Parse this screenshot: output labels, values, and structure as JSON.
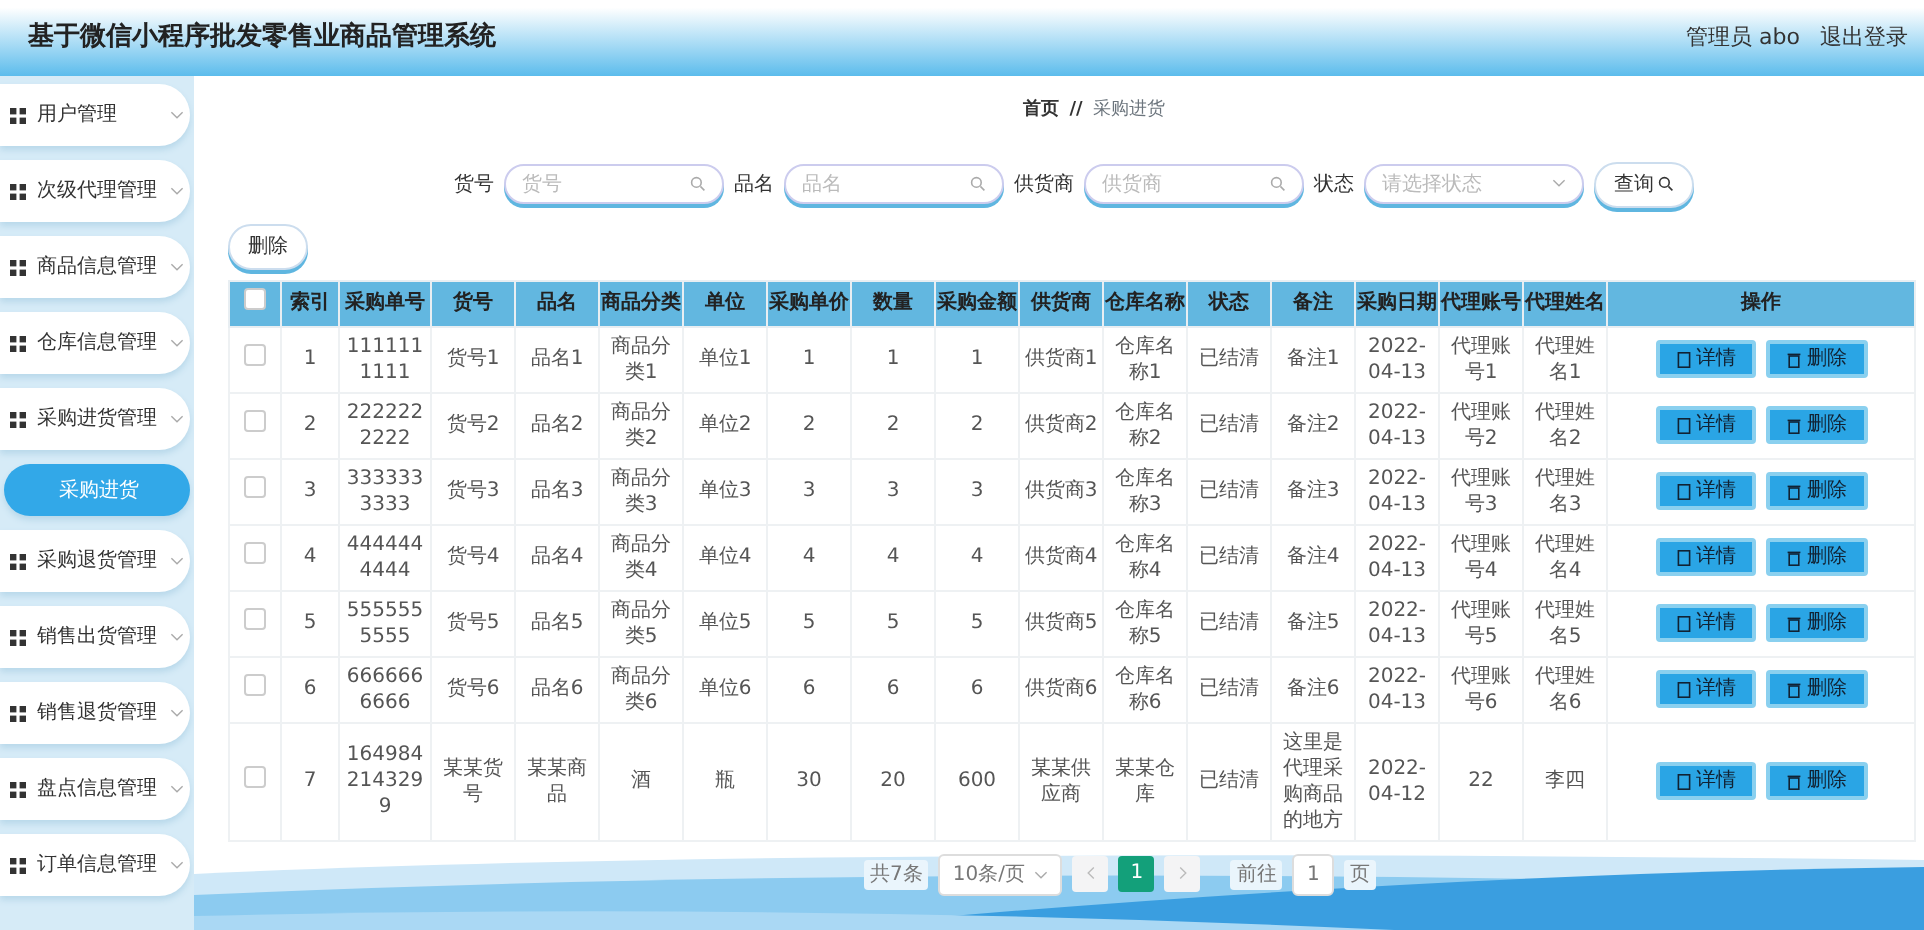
{
  "header": {
    "title": "基于微信小程序批发零售业商品管理系统",
    "user": "管理员 abo",
    "logout": "退出登录"
  },
  "sidebar": {
    "items": [
      {
        "kind": "menu",
        "label": "用户管理",
        "selected": false
      },
      {
        "kind": "menu",
        "label": "次级代理管理",
        "selected": false
      },
      {
        "kind": "menu",
        "label": "商品信息管理",
        "selected": false
      },
      {
        "kind": "menu",
        "label": "仓库信息管理",
        "selected": false
      },
      {
        "kind": "menu",
        "label": "采购进货管理",
        "selected": false
      },
      {
        "kind": "submenu",
        "label": "采购进货",
        "selected": true
      },
      {
        "kind": "menu",
        "label": "采购退货管理",
        "selected": false
      },
      {
        "kind": "menu",
        "label": "销售出货管理",
        "selected": false
      },
      {
        "kind": "menu",
        "label": "销售退货管理",
        "selected": false
      },
      {
        "kind": "menu",
        "label": "盘点信息管理",
        "selected": false
      },
      {
        "kind": "menu",
        "label": "订单信息管理",
        "selected": false
      }
    ]
  },
  "breadcrumb": {
    "home": "首页",
    "separator": "//",
    "current": "采购进货"
  },
  "filters": [
    {
      "kind": "search",
      "label": "货号",
      "placeholder": "货号"
    },
    {
      "kind": "search",
      "label": "品名",
      "placeholder": "品名"
    },
    {
      "kind": "search",
      "label": "供货商",
      "placeholder": "供货商"
    },
    {
      "kind": "select",
      "label": "状态",
      "placeholder": "请选择状态"
    }
  ],
  "query_button": "查询",
  "delete_button": "删除",
  "table": {
    "select_all_checked": false,
    "columns": [
      "索引",
      "采购单号",
      "货号",
      "品名",
      "商品分类",
      "单位",
      "采购单价",
      "数量",
      "采购金额",
      "供货商",
      "仓库名称",
      "状态",
      "备注",
      "采购日期",
      "代理账号",
      "代理姓名",
      "操作"
    ],
    "rows": [
      {
        "checked": false,
        "cells": [
          "1",
          "1111111111",
          "货号1",
          "品名1",
          "商品分类1",
          "单位1",
          "1",
          "1",
          "1",
          "供货商1",
          "仓库名称1",
          "已结清",
          "备注1",
          "2022-04-13",
          "代理账号1",
          "代理姓名1"
        ],
        "actions": [
          "详情",
          "删除"
        ]
      },
      {
        "checked": false,
        "cells": [
          "2",
          "2222222222",
          "货号2",
          "品名2",
          "商品分类2",
          "单位2",
          "2",
          "2",
          "2",
          "供货商2",
          "仓库名称2",
          "已结清",
          "备注2",
          "2022-04-13",
          "代理账号2",
          "代理姓名2"
        ],
        "actions": [
          "详情",
          "删除"
        ]
      },
      {
        "checked": false,
        "cells": [
          "3",
          "3333333333",
          "货号3",
          "品名3",
          "商品分类3",
          "单位3",
          "3",
          "3",
          "3",
          "供货商3",
          "仓库名称3",
          "已结清",
          "备注3",
          "2022-04-13",
          "代理账号3",
          "代理姓名3"
        ],
        "actions": [
          "详情",
          "删除"
        ]
      },
      {
        "checked": false,
        "cells": [
          "4",
          "4444444444",
          "货号4",
          "品名4",
          "商品分类4",
          "单位4",
          "4",
          "4",
          "4",
          "供货商4",
          "仓库名称4",
          "已结清",
          "备注4",
          "2022-04-13",
          "代理账号4",
          "代理姓名4"
        ],
        "actions": [
          "详情",
          "删除"
        ]
      },
      {
        "checked": false,
        "cells": [
          "5",
          "5555555555",
          "货号5",
          "品名5",
          "商品分类5",
          "单位5",
          "5",
          "5",
          "5",
          "供货商5",
          "仓库名称5",
          "已结清",
          "备注5",
          "2022-04-13",
          "代理账号5",
          "代理姓名5"
        ],
        "actions": [
          "详情",
          "删除"
        ]
      },
      {
        "checked": false,
        "cells": [
          "6",
          "6666666666",
          "货号6",
          "品名6",
          "商品分类6",
          "单位6",
          "6",
          "6",
          "6",
          "供货商6",
          "仓库名称6",
          "已结清",
          "备注6",
          "2022-04-13",
          "代理账号6",
          "代理姓名6"
        ],
        "actions": [
          "详情",
          "删除"
        ]
      },
      {
        "checked": false,
        "cells": [
          "7",
          "1649842143299",
          "某某货号",
          "某某商品",
          "酒",
          "瓶",
          "30",
          "20",
          "600",
          "某某供应商",
          "某某仓库",
          "已结清",
          "这里是代理采购商品的地方",
          "2022-04-12",
          "22",
          "李四"
        ],
        "actions": [
          "详情",
          "删除"
        ]
      }
    ]
  },
  "pagination": {
    "total": "共7条",
    "page_size": "10条/页",
    "pages": [
      {
        "label": "1",
        "selected": true
      }
    ],
    "goto_label": "前往",
    "goto_value": "1",
    "goto_suffix": "页"
  }
}
